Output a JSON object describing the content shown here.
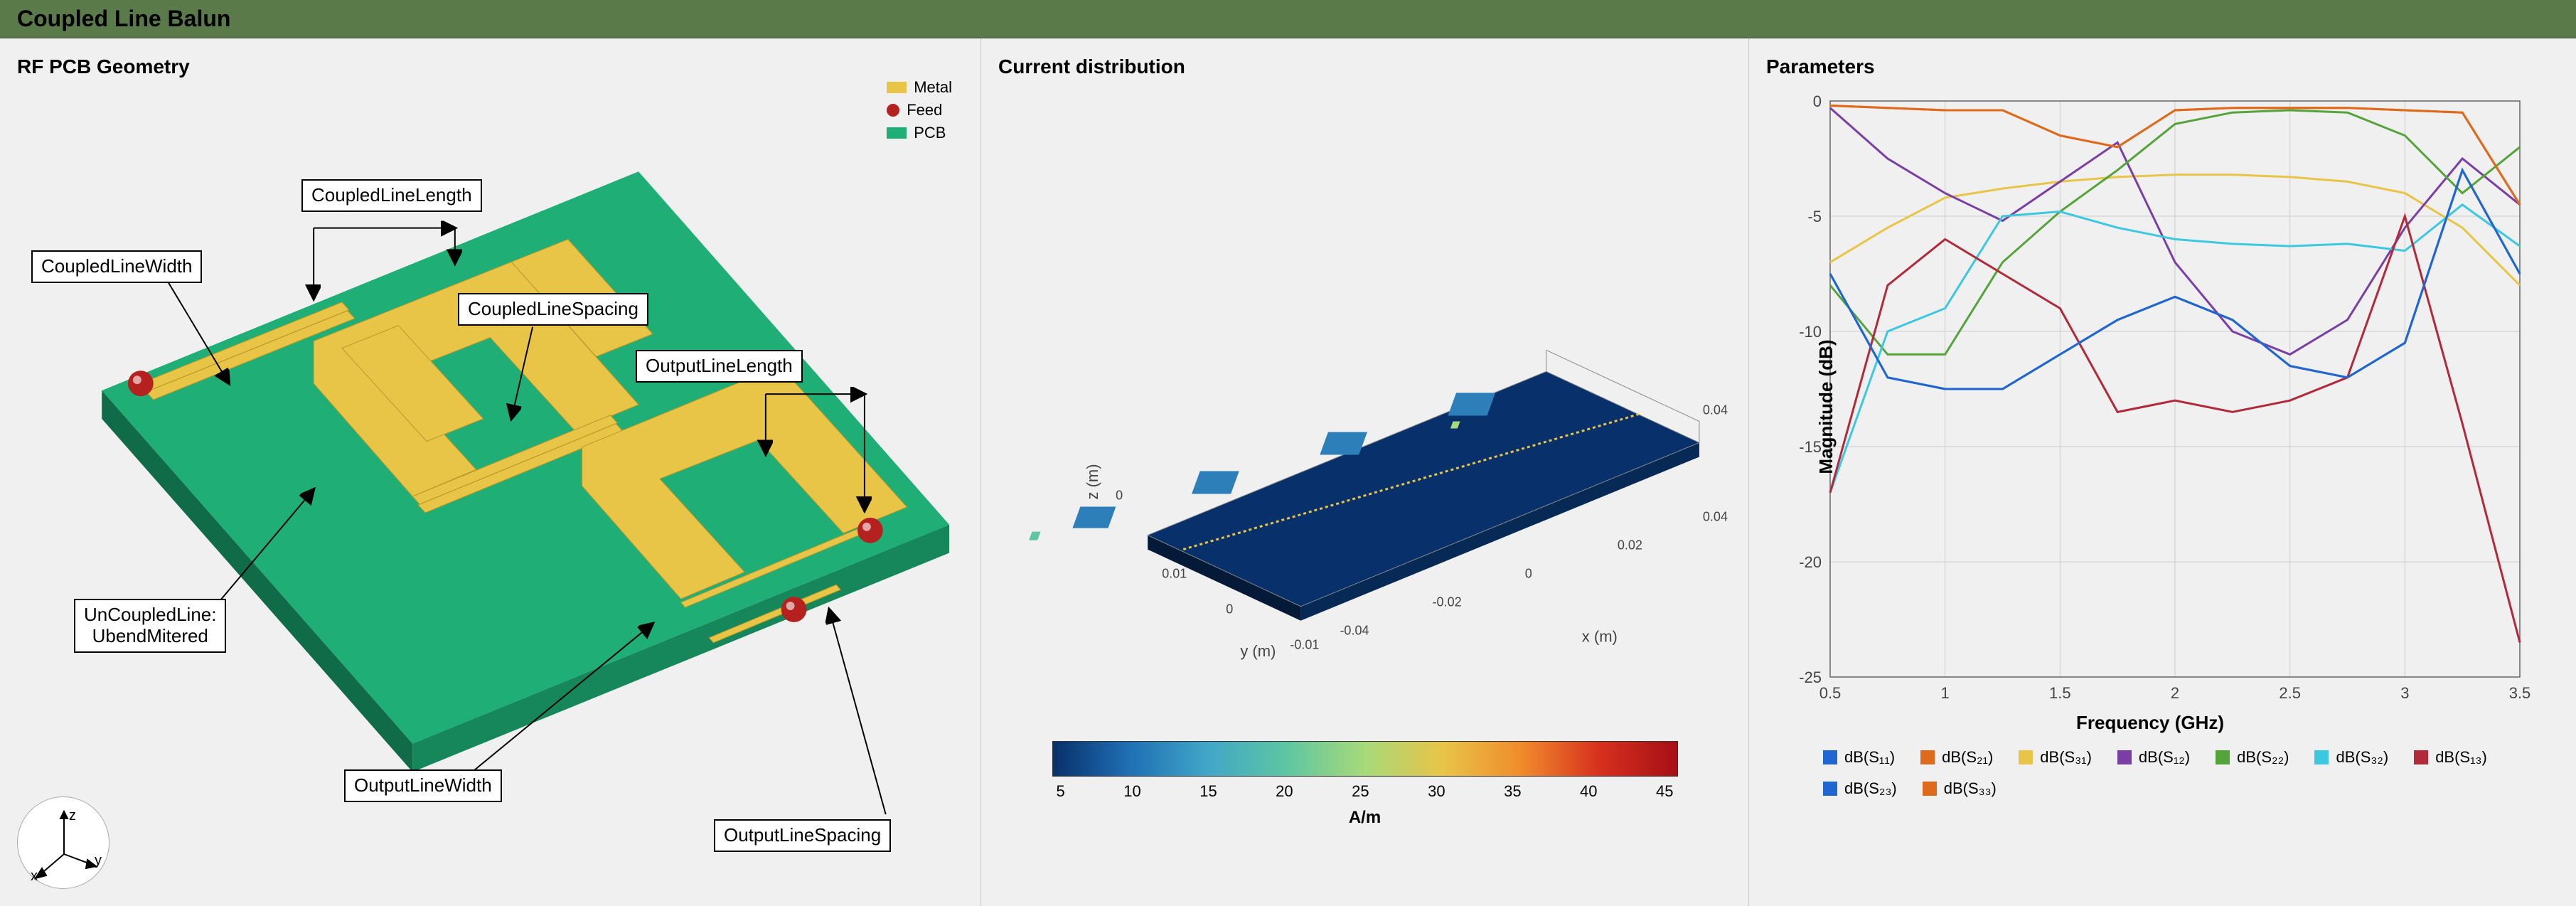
{
  "title": "Coupled Line Balun",
  "panel1": {
    "title": "RF PCB Geometry",
    "legend": {
      "metal": "Metal",
      "feed": "Feed",
      "pcb": "PCB"
    },
    "annotations": {
      "coupled_line_width": "CoupledLineWidth",
      "coupled_line_length": "CoupledLineLength",
      "coupled_line_spacing": "CoupledLineSpacing",
      "uncoupled_line": "UnCoupledLine:\nUbendMitered",
      "output_line_width": "OutputLineWidth",
      "output_line_length": "OutputLineLength",
      "output_line_spacing": "OutputLineSpacing"
    },
    "axes": {
      "x": "x",
      "y": "y",
      "z": "z"
    }
  },
  "panel2": {
    "title": "Current distribution",
    "x_ticks": [
      "-0.04",
      "-0.02",
      "0",
      "0.02",
      "0.04"
    ],
    "y_ticks": [
      "-0.01",
      "0",
      "0.01"
    ],
    "z_ticks": [
      "0.04"
    ],
    "xlabel": "x (m)",
    "ylabel": "y (m)",
    "zlabel": "z (m)",
    "colorbar_ticks": [
      "5",
      "10",
      "15",
      "20",
      "25",
      "30",
      "35",
      "40",
      "45"
    ],
    "unit": "A/m"
  },
  "panel3": {
    "title": "Parameters",
    "xlabel": "Frequency (GHz)",
    "ylabel": "Magnitude (dB)"
  },
  "chart_data": {
    "type": "line",
    "xlabel": "Frequency (GHz)",
    "ylabel": "Magnitude (dB)",
    "xlim": [
      0.5,
      3.5
    ],
    "ylim": [
      -25,
      0
    ],
    "xticks": [
      0.5,
      1,
      1.5,
      2,
      2.5,
      3,
      3.5
    ],
    "yticks": [
      -25,
      -20,
      -15,
      -10,
      -5,
      0
    ],
    "x": [
      0.5,
      0.75,
      1.0,
      1.25,
      1.5,
      1.75,
      2.0,
      2.25,
      2.5,
      2.75,
      3.0,
      3.25,
      3.5
    ],
    "series": [
      {
        "name": "dB(S11)",
        "color": "#1f66d1",
        "values": [
          -7.5,
          -12.0,
          -12.5,
          -12.5,
          -11.0,
          -9.5,
          -8.5,
          -9.5,
          -11.5,
          -12.0,
          -10.5,
          -3.0,
          -7.5
        ]
      },
      {
        "name": "dB(S21)",
        "color": "#e06a1c",
        "values": [
          -0.2,
          -0.3,
          -0.4,
          -0.4,
          -1.5,
          -2.0,
          -0.4,
          -0.3,
          -0.3,
          -0.3,
          -0.4,
          -0.5,
          -4.5
        ]
      },
      {
        "name": "dB(S31)",
        "color": "#e8c447",
        "values": [
          -7.0,
          -5.5,
          -4.2,
          -3.8,
          -3.5,
          -3.3,
          -3.2,
          -3.2,
          -3.3,
          -3.5,
          -4.0,
          -5.5,
          -8.0
        ]
      },
      {
        "name": "dB(S12)",
        "color": "#7a3fa5",
        "values": [
          -0.3,
          -2.5,
          -4.0,
          -5.2,
          -3.5,
          -1.8,
          -7.0,
          -10.0,
          -11.0,
          -9.5,
          -5.5,
          -2.5,
          -4.5
        ]
      },
      {
        "name": "dB(S22)",
        "color": "#55a33b",
        "values": [
          -8.0,
          -11.0,
          -11.0,
          -7.0,
          -4.8,
          -3.0,
          -1.0,
          -0.5,
          -0.4,
          -0.5,
          -1.5,
          -4.0,
          -2.0
        ]
      },
      {
        "name": "dB(S32)",
        "color": "#3cc8e0",
        "values": [
          -17.0,
          -10.0,
          -9.0,
          -5.0,
          -4.8,
          -5.5,
          -6.0,
          -6.2,
          -6.3,
          -6.2,
          -6.5,
          -4.5,
          -6.3
        ]
      },
      {
        "name": "dB(S13)",
        "color": "#b02a3a",
        "values": [
          -17.0,
          -8.0,
          -6.0,
          -7.5,
          -9.0,
          -13.5,
          -13.0,
          -13.5,
          -13.0,
          -12.0,
          -5.0,
          -14.0,
          -23.5
        ]
      },
      {
        "name": "dB(S23)",
        "color": "#1f66d1",
        "values": [
          -7.5,
          -12.0,
          -12.5,
          -12.5,
          -11.0,
          -9.5,
          -8.5,
          -9.5,
          -11.5,
          -12.0,
          -10.5,
          -3.0,
          -7.5
        ]
      },
      {
        "name": "dB(S33)",
        "color": "#e06a1c",
        "values": [
          -0.2,
          -0.3,
          -0.4,
          -0.4,
          -1.5,
          -2.0,
          -0.4,
          -0.3,
          -0.3,
          -0.3,
          -0.4,
          -0.5,
          -4.5
        ]
      }
    ],
    "legend_labels": [
      "dB(S₁₁)",
      "dB(S₂₁)",
      "dB(S₃₁)",
      "dB(S₁₂)",
      "dB(S₂₂)",
      "dB(S₃₂)",
      "dB(S₁₃)",
      "dB(S₂₃)",
      "dB(S₃₃)"
    ]
  }
}
